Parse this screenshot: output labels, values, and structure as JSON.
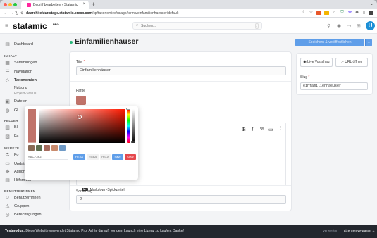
{
  "browser": {
    "tab_title": "Begriff bearbeiten ‹ Statamic",
    "tab_close": "×",
    "new_tab": "+",
    "url_host": "daarchitektur.stage.statamic.creox.com",
    "url_path": "/cp/taxonomies/usage/terms/einfamilienhaeuser/default"
  },
  "header": {
    "logo": "statamic",
    "logo_badge": "PRO",
    "search_placeholder": "Suchen...",
    "search_shortcut": "/"
  },
  "sidebar": {
    "top_items": [
      {
        "label": "Dashboard",
        "icon": "dashboard-icon"
      }
    ],
    "section_inhalt": "INHALT",
    "inhalt_items": [
      {
        "label": "Sammlungen",
        "icon": "collections-icon"
      },
      {
        "label": "Navigation",
        "icon": "navigation-icon"
      },
      {
        "label": "Taxonomien",
        "icon": "taxonomies-icon"
      }
    ],
    "taxonomy_subitems": [
      "Nutzung",
      "Projekt-Status"
    ],
    "inhalt_after": [
      {
        "label": "Dateien",
        "icon": "files-icon"
      },
      {
        "label": "Gl",
        "icon": "globals-icon"
      }
    ],
    "section_felder": "FELDER",
    "felder_items": [
      {
        "label": "Bl",
        "icon": "blueprints-icon"
      },
      {
        "label": "Fe",
        "icon": "fieldsets-icon"
      }
    ],
    "section_werkzeuge": "WERKZE",
    "werkzeuge_items": [
      {
        "label": "Fo",
        "icon": "forms-icon"
      },
      {
        "label": "Updates",
        "icon": "updates-icon",
        "badge": "1"
      },
      {
        "label": "Addons",
        "icon": "addons-icon"
      },
      {
        "label": "Hilfsmittel",
        "icon": "utilities-icon"
      }
    ],
    "section_benutzer": "BENUTZER*INNEN",
    "benutzer_items": [
      {
        "label": "Benutzer*innen",
        "icon": "users-icon"
      },
      {
        "label": "Gruppen",
        "icon": "groups-icon"
      },
      {
        "label": "Berechtigungen",
        "icon": "permissions-icon"
      }
    ]
  },
  "main": {
    "page_title": "Einfamilienhäuser",
    "save_label": "Speichern & veröffentlichen",
    "title_label": "Titel",
    "title_value": "Einfamilienhäuser",
    "farbe_label": "Farbe",
    "farbe_value": "#C0736A",
    "editor_tools": [
      "B",
      "I",
      "%",
      "▭",
      "⛶"
    ],
    "markdown_badge": "M↓",
    "markdown_hint": "Markdown-Spickzettel",
    "sort_label": "Sortierung",
    "sort_value": "2"
  },
  "right_panel": {
    "live_preview": "Live Vorschau",
    "open_url": "URL öffnen",
    "slug_label": "Slug",
    "slug_value": "einfamilienhaeuser"
  },
  "picker": {
    "hex_value": "#BC7362",
    "swatches": [
      "#8a6a55",
      "#5e6e4f",
      "#a56a5d",
      "#c98b6d",
      "#6f9ac6"
    ],
    "modes": [
      "HEXA",
      "RGBA",
      "HSLA"
    ],
    "save_label": "Save",
    "clear_label": "Clear"
  },
  "status": {
    "prefix": "Testmodus:",
    "message": "Diese Website verwendet Statamic Pro. Achte darauf, vor dem Launch eine Lizenz zu kaufen. Danke!",
    "right_text": "Verwerfen",
    "license_button": "Lizenzen verwalten →"
  },
  "colors": {
    "accent": "#5f9ee9",
    "published_dot": "#27b67a",
    "statusbar": "#23272e"
  }
}
